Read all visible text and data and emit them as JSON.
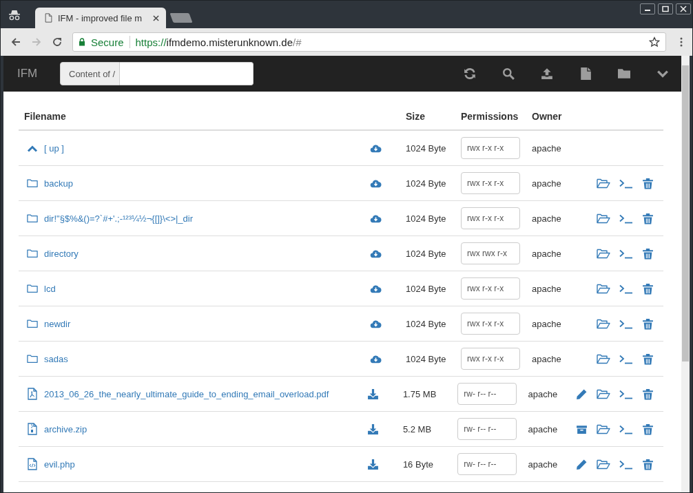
{
  "browser": {
    "tab_title": "IFM - improved file m",
    "secure_label": "Secure",
    "url_scheme": "https://",
    "url_host": "ifmdemo.misterunknown.de",
    "url_path": "/#"
  },
  "navbar": {
    "brand": "IFM",
    "path_label": "Content of /"
  },
  "table": {
    "columns": [
      "Filename",
      "Size",
      "Permissions",
      "Owner"
    ],
    "rows": [
      {
        "kind": "up",
        "name": "[ up ]",
        "size": "1024 Byte",
        "permissions": "rwx r-x r-x",
        "owner": "apache"
      },
      {
        "kind": "dir",
        "name": "backup",
        "size": "1024 Byte",
        "permissions": "rwx r-x r-x",
        "owner": "apache"
      },
      {
        "kind": "dir",
        "name": "dir!\"§$%&()=?`#+'.;-¹²³¼½¬{[]}\\<>|_dir",
        "size": "1024 Byte",
        "permissions": "rwx r-x r-x",
        "owner": "apache"
      },
      {
        "kind": "dir",
        "name": "directory",
        "size": "1024 Byte",
        "permissions": "rwx rwx r-x",
        "owner": "apache"
      },
      {
        "kind": "dir",
        "name": "lcd",
        "size": "1024 Byte",
        "permissions": "rwx r-x r-x",
        "owner": "apache"
      },
      {
        "kind": "dir",
        "name": "newdir",
        "size": "1024 Byte",
        "permissions": "rwx r-x r-x",
        "owner": "apache"
      },
      {
        "kind": "dir",
        "name": "sadas",
        "size": "1024 Byte",
        "permissions": "rwx r-x r-x",
        "owner": "apache"
      },
      {
        "kind": "pdf",
        "name": "2013_06_26_the_nearly_ultimate_guide_to_ending_email_overload.pdf",
        "size": "1.75 MB",
        "permissions": "rw- r-- r--",
        "owner": "apache",
        "editable": true,
        "extractable": false
      },
      {
        "kind": "zip",
        "name": "archive.zip",
        "size": "5.2 MB",
        "permissions": "rw- r-- r--",
        "owner": "apache",
        "editable": false,
        "extractable": true
      },
      {
        "kind": "php",
        "name": "evil.php",
        "size": "16 Byte",
        "permissions": "rw- r-- r--",
        "owner": "apache",
        "editable": true,
        "extractable": false
      }
    ]
  }
}
